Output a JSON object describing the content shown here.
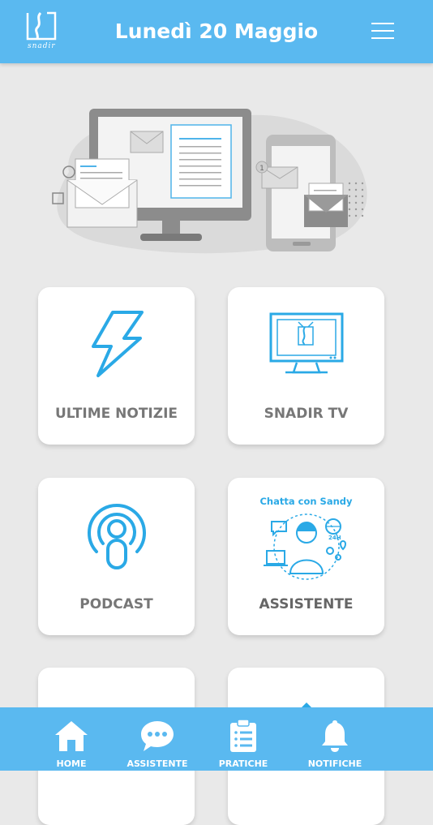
{
  "header": {
    "logo_text": "snadir",
    "title": "Lunedì 20 Maggio",
    "menu_icon": "hamburger-menu-icon"
  },
  "hero": {
    "illustration": "devices-mail-illustration",
    "phone_badge": "1"
  },
  "cards": [
    {
      "label": "ULTIME NOTIZIE",
      "icon": "lightning-bolt-icon"
    },
    {
      "label": "SNADIR TV",
      "icon": "tv-monitor-icon"
    },
    {
      "label": "PODCAST",
      "icon": "podcast-icon"
    },
    {
      "label": "ASSISTENTE",
      "icon": "chatbot-assistant-icon",
      "caption": "Chatta con Sandy",
      "badge": "24H"
    },
    {
      "label": "",
      "icon": "open-book-icon"
    },
    {
      "label": "",
      "icon": "partial-icon"
    }
  ],
  "tabbar": {
    "items": [
      {
        "label": "HOME",
        "icon": "home-icon"
      },
      {
        "label": "ASSISTENTE",
        "icon": "chat-bubble-icon"
      },
      {
        "label": "PRATICHE",
        "icon": "clipboard-icon"
      },
      {
        "label": "NOTIFICHE",
        "icon": "bell-icon"
      }
    ]
  },
  "colors": {
    "header_bg": "#5ab9f0",
    "accent": "#2aa9e6",
    "page_bg": "#e9e9e9",
    "card_label": "#777777"
  }
}
